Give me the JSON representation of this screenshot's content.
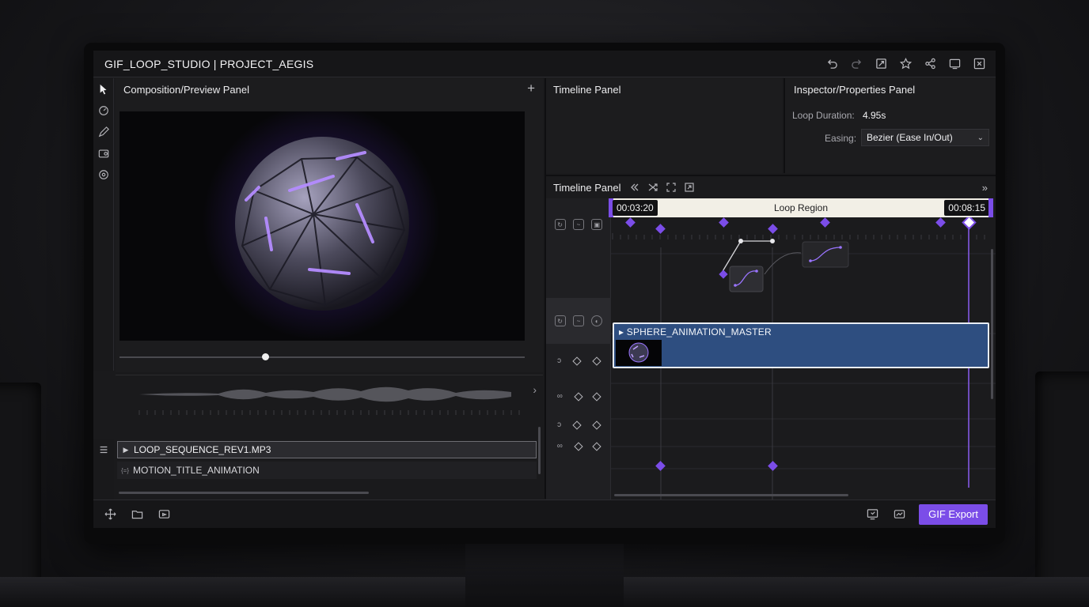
{
  "window": {
    "title": "GIF_LOOP_STUDIO | PROJECT_AEGIS"
  },
  "title_icons": [
    "undo-icon",
    "redo-icon",
    "expand-icon",
    "star-icon",
    "share-icon",
    "monitor-icon",
    "close-icon"
  ],
  "tools": [
    "pointer-icon",
    "lasso-icon",
    "pen-icon",
    "camera-icon",
    "target-icon"
  ],
  "composition": {
    "title": "Composition/Preview Panel",
    "add_label": "+",
    "scrub_fraction": 0.36
  },
  "layers": [
    {
      "name": "LOOP_SEQUENCE_REV1.MP3",
      "selected": true
    },
    {
      "name": "MOTION_TITLE_ANIMATION",
      "selected": false
    }
  ],
  "timeline_top": {
    "title": "Timeline Panel"
  },
  "inspector": {
    "title": "Inspector/Properties Panel",
    "loop_duration_label": "Loop Duration:",
    "loop_duration_value": "4.95s",
    "easing_label": "Easing:",
    "easing_value": "Bezier (Ease In/Out)"
  },
  "timeline": {
    "title": "Timeline Panel",
    "loop_start": "00:03:20",
    "loop_end": "00:08:15",
    "loop_label": "Loop Region",
    "clip_name": "SPHERE_ANIMATION_MASTER"
  },
  "bottom": {
    "export_label": "GIF Export"
  },
  "colors": {
    "accent": "#7b4de8",
    "clip": "#2e4e80",
    "loop_bar": "#f2efe6"
  }
}
